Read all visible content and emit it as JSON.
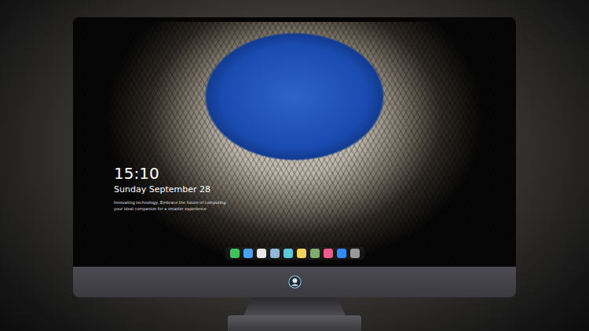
{
  "lock_screen": {
    "time": "15:10",
    "date": "Sunday September 28",
    "tagline": [
      "Innovating technology, Embrace the future of computing",
      "your ideal companion for a smarter experience"
    ]
  },
  "dock": [
    {
      "color": "#3cc35a"
    },
    {
      "color": "#4aa3f0"
    },
    {
      "color": "#e8e8e8"
    },
    {
      "color": "#8fb7d8"
    },
    {
      "color": "#5ac8d8"
    },
    {
      "color": "#f4d35e"
    },
    {
      "color": "#7fae6c"
    },
    {
      "color": "#f05a8c"
    },
    {
      "color": "#2f8df5"
    },
    {
      "color": "#9a9a9a"
    }
  ]
}
